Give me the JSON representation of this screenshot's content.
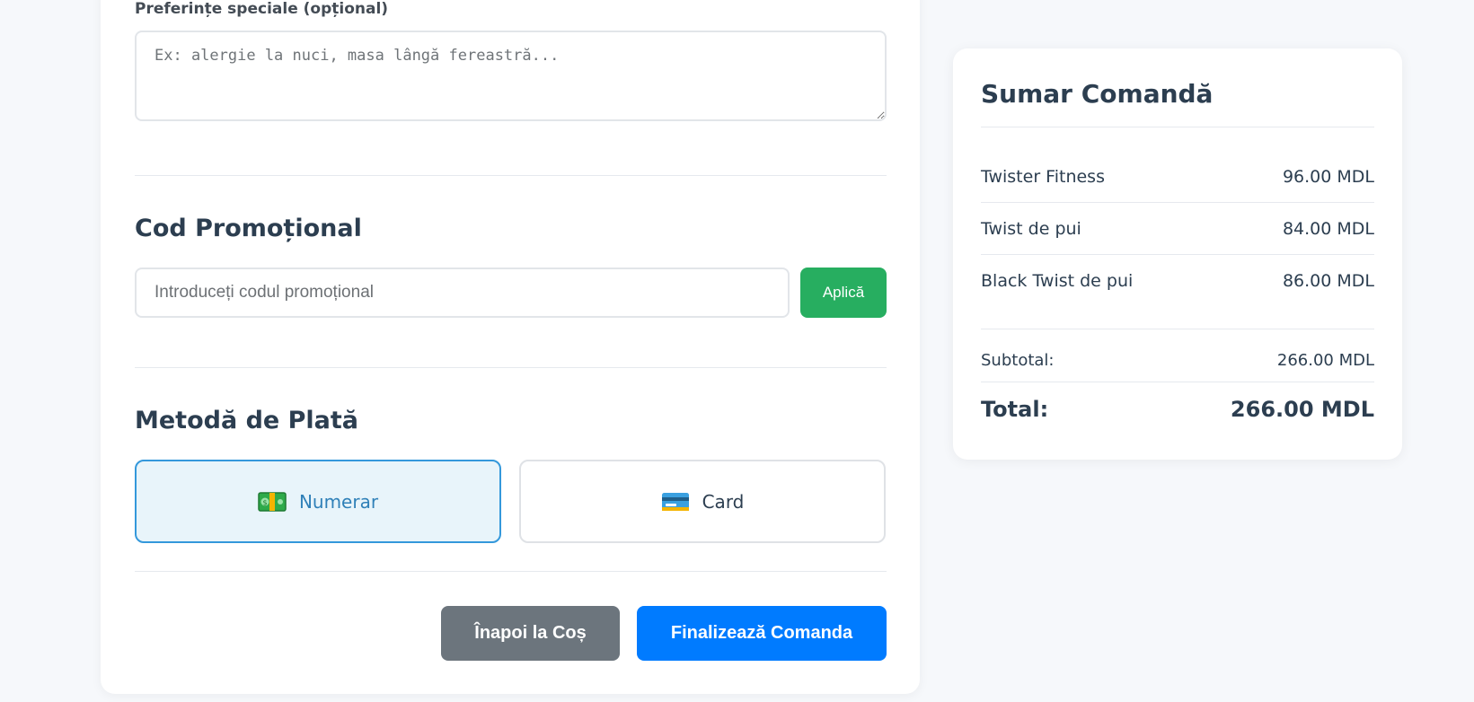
{
  "form": {
    "preferences_label": "Preferințe speciale (opțional)",
    "preferences_placeholder": "Ex: alergie la nuci, masa lângă fereastră...",
    "promo_title": "Cod Promoțional",
    "promo_placeholder": "Introduceți codul promoțional",
    "promo_apply_label": "Aplică",
    "payment_title": "Metodă de Plată",
    "payment_options": [
      {
        "label": "Numerar",
        "icon": "cash-icon",
        "selected": true
      },
      {
        "label": "Card",
        "icon": "credit-card-icon",
        "selected": false
      }
    ],
    "back_label": "Înapoi la Coș",
    "finalize_label": "Finalizează Comanda"
  },
  "summary": {
    "title": "Sumar Comandă",
    "items": [
      {
        "name": "Twister Fitness",
        "price": "96.00 MDL"
      },
      {
        "name": "Twist de pui",
        "price": "84.00 MDL"
      },
      {
        "name": "Black Twist de pui",
        "price": "86.00 MDL"
      }
    ],
    "subtotal_label": "Subtotal:",
    "subtotal_value": "266.00 MDL",
    "total_label": "Total:",
    "total_value": "266.00 MDL"
  },
  "colors": {
    "apply_green": "#27ae60",
    "selected_blue": "#3498db",
    "back_gray": "#6c757d",
    "finalize_blue": "#007bff"
  }
}
